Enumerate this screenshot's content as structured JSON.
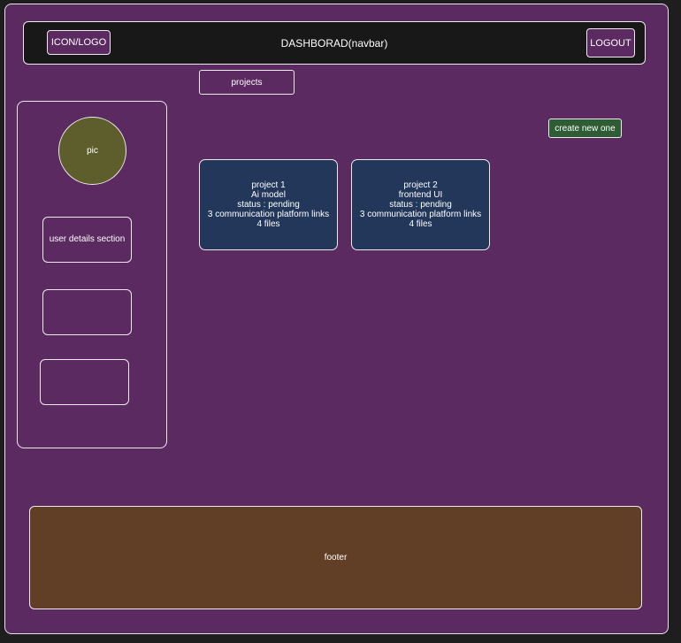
{
  "navbar": {
    "logo_label": "ICON/LOGO",
    "title": "DASHBORAD(navbar)",
    "logout_label": "LOGOUT"
  },
  "tabs": {
    "projects_label": "projects"
  },
  "sidebar": {
    "avatar_label": "pic",
    "user_details_label": "user details section",
    "box2_label": "",
    "box3_label": ""
  },
  "actions": {
    "create_label": "create new one"
  },
  "projects": [
    {
      "name": "project 1",
      "subtitle": "Ai model",
      "status": "status : pending",
      "links": "3 communication platform links",
      "files": "4 files"
    },
    {
      "name": "project 2",
      "subtitle": "frontend UI",
      "status": "status : pending",
      "links": "3 communication platform links",
      "files": "4 files"
    }
  ],
  "footer": {
    "label": "footer"
  }
}
